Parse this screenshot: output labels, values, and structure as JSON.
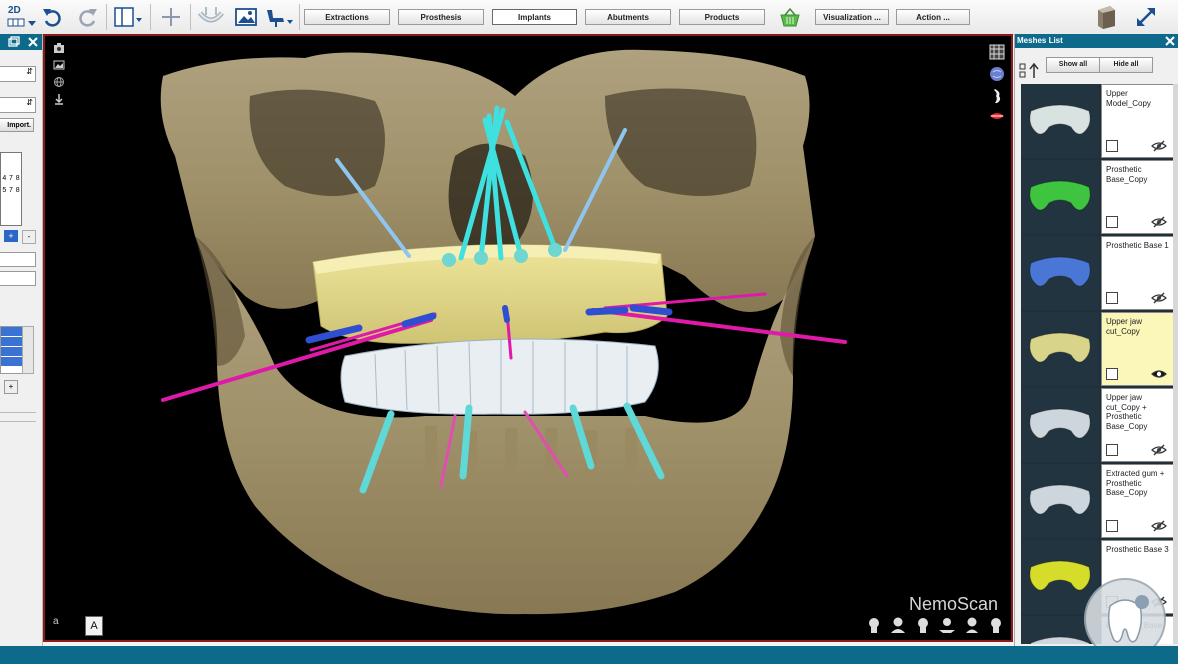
{
  "toolbar": {
    "mode_label": "2D",
    "buttons": [
      "Extractions",
      "Prosthesis",
      "Implants",
      "Abutments",
      "Products",
      "Visualization ...",
      "Action ..."
    ],
    "active_button": "Implants"
  },
  "left_panel": {
    "import_label": "Import.",
    "grid_row1": [
      "4",
      "7",
      "8"
    ],
    "grid_row2": [
      "5",
      "7",
      "8"
    ]
  },
  "viewport": {
    "watermark": "NemoScan",
    "corner_label": "a",
    "annotation_button": "A"
  },
  "meshes_panel": {
    "title": "Meshes List",
    "show_all": "Show all",
    "hide_all": "Hide all",
    "items": [
      {
        "name": "Upper Model_Copy",
        "color": "#d8e2e0",
        "visible": false
      },
      {
        "name": "Prosthetic Base_Copy",
        "color": "#3ec43e",
        "visible": false
      },
      {
        "name": "Prosthetic Base 1",
        "color": "#4a76d6",
        "visible": false
      },
      {
        "name": "Upper jaw cut_Copy",
        "color": "#d8d48a",
        "visible": true,
        "selected": true
      },
      {
        "name": "Upper jaw cut_Copy + Prosthetic Base_Copy",
        "color": "#cdd6dc",
        "visible": false
      },
      {
        "name": "Extracted gum + Prosthetic Base_Copy",
        "color": "#cdd6dc",
        "visible": false
      },
      {
        "name": "Prosthetic Base 3",
        "color": "#d6dc2a",
        "visible": false
      },
      {
        "name": "Prosthetic Base",
        "color": "#cdd6dc",
        "visible": false
      }
    ]
  }
}
